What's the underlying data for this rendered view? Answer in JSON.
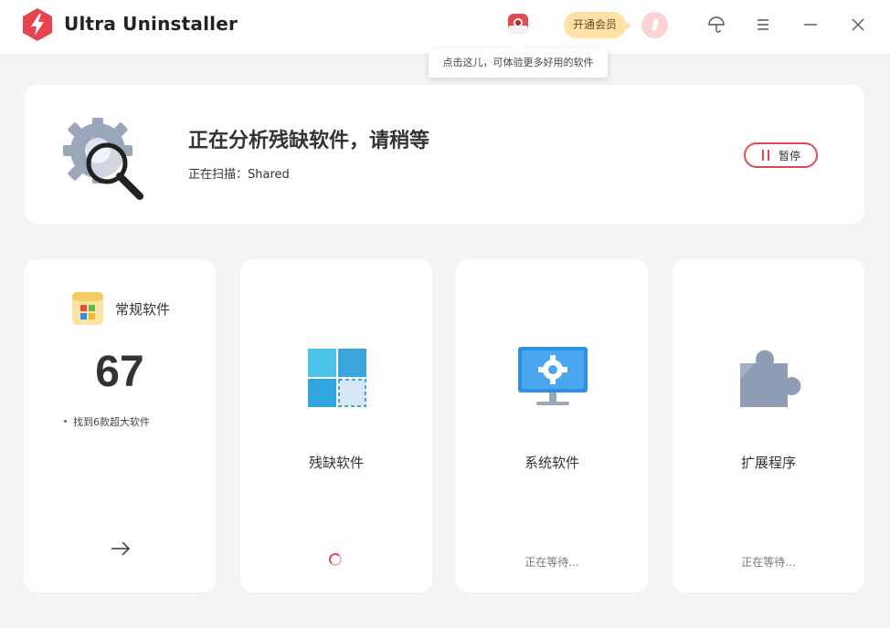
{
  "app": {
    "title": "Ultra Uninstaller",
    "accent": "#e14b55"
  },
  "header": {
    "vip_label": "开通会员",
    "tooltip": "点击这儿，可体验更多好用的软件",
    "icons": [
      "promo-app-icon",
      "avatar",
      "umbrella-icon",
      "menu-icon",
      "minimize-icon",
      "close-icon"
    ]
  },
  "scan": {
    "title": "正在分析残缺软件，请稍等",
    "status_prefix": "正在扫描：",
    "status_value": "Shared",
    "pause_label": "暂停"
  },
  "categories": [
    {
      "label": "常规软件",
      "count": "67",
      "note": "找到6款超大软件",
      "icon": "regular-software-icon",
      "action": "arrow-right-icon"
    },
    {
      "label": "残缺软件",
      "status": "loading-spinner",
      "icon": "incomplete-software-icon"
    },
    {
      "label": "系统软件",
      "wait": "正在等待...",
      "icon": "system-software-icon"
    },
    {
      "label": "扩展程序",
      "wait": "正在等待...",
      "icon": "extension-icon"
    }
  ]
}
